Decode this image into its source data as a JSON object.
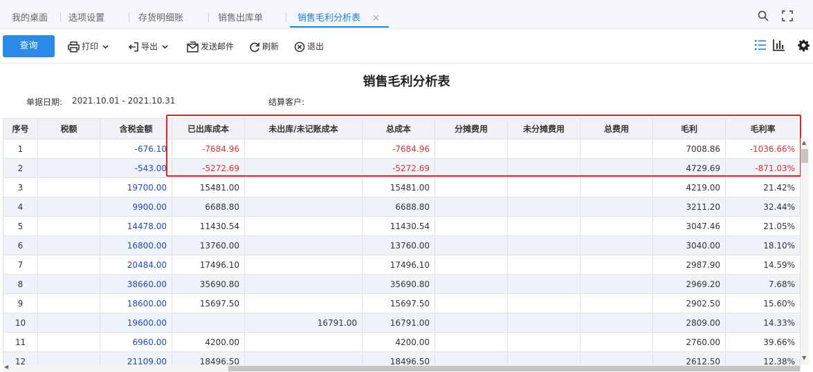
{
  "tabs": [
    {
      "label": "我的桌面"
    },
    {
      "label": "选项设置"
    },
    {
      "label": "存货明细账"
    },
    {
      "label": "销售出库单"
    },
    {
      "label": "销售毛利分析表"
    }
  ],
  "tab_close": "×",
  "toolbar": {
    "query": "查询",
    "print": "打印",
    "export": "导出",
    "send_mail": "发送邮件",
    "refresh": "刷新",
    "exit": "退出"
  },
  "report": {
    "title": "销售毛利分析表",
    "date_label": "单据日期:",
    "date_value": "2021.10.01 - 2021.10.31",
    "customer_label": "结算客户:",
    "customer_value": ""
  },
  "columns": [
    "序号",
    "税额",
    "含税金额",
    "已出库成本",
    "未出库/未记账成本",
    "总成本",
    "分摊费用",
    "未分摊费用",
    "总费用",
    "毛利",
    "毛利率"
  ],
  "rows": [
    {
      "seq": "1",
      "tax": "",
      "amount": "-676.10",
      "out_cost": "-7684.96",
      "unposted_cost": "",
      "total_cost": "-7684.96",
      "alloc_fee": "",
      "unalloc_fee": "",
      "total_fee": "",
      "profit": "7008.86",
      "margin": "-1036.66%",
      "neg": true
    },
    {
      "seq": "2",
      "tax": "",
      "amount": "-543.00",
      "out_cost": "-5272.69",
      "unposted_cost": "",
      "total_cost": "-5272.69",
      "alloc_fee": "",
      "unalloc_fee": "",
      "total_fee": "",
      "profit": "4729.69",
      "margin": "-871.03%",
      "neg": true
    },
    {
      "seq": "3",
      "tax": "",
      "amount": "19700.00",
      "out_cost": "15481.00",
      "unposted_cost": "",
      "total_cost": "15481.00",
      "alloc_fee": "",
      "unalloc_fee": "",
      "total_fee": "",
      "profit": "4219.00",
      "margin": "21.42%",
      "neg": false
    },
    {
      "seq": "4",
      "tax": "",
      "amount": "9900.00",
      "out_cost": "6688.80",
      "unposted_cost": "",
      "total_cost": "6688.80",
      "alloc_fee": "",
      "unalloc_fee": "",
      "total_fee": "",
      "profit": "3211.20",
      "margin": "32.44%",
      "neg": false
    },
    {
      "seq": "5",
      "tax": "",
      "amount": "14478.00",
      "out_cost": "11430.54",
      "unposted_cost": "",
      "total_cost": "11430.54",
      "alloc_fee": "",
      "unalloc_fee": "",
      "total_fee": "",
      "profit": "3047.46",
      "margin": "21.05%",
      "neg": false
    },
    {
      "seq": "6",
      "tax": "",
      "amount": "16800.00",
      "out_cost": "13760.00",
      "unposted_cost": "",
      "total_cost": "13760.00",
      "alloc_fee": "",
      "unalloc_fee": "",
      "total_fee": "",
      "profit": "3040.00",
      "margin": "18.10%",
      "neg": false
    },
    {
      "seq": "7",
      "tax": "",
      "amount": "20484.00",
      "out_cost": "17496.10",
      "unposted_cost": "",
      "total_cost": "17496.10",
      "alloc_fee": "",
      "unalloc_fee": "",
      "total_fee": "",
      "profit": "2987.90",
      "margin": "14.59%",
      "neg": false
    },
    {
      "seq": "8",
      "tax": "",
      "amount": "38660.00",
      "out_cost": "35690.80",
      "unposted_cost": "",
      "total_cost": "35690.80",
      "alloc_fee": "",
      "unalloc_fee": "",
      "total_fee": "",
      "profit": "2969.20",
      "margin": "7.68%",
      "neg": false
    },
    {
      "seq": "9",
      "tax": "",
      "amount": "18600.00",
      "out_cost": "15697.50",
      "unposted_cost": "",
      "total_cost": "15697.50",
      "alloc_fee": "",
      "unalloc_fee": "",
      "total_fee": "",
      "profit": "2902.50",
      "margin": "15.60%",
      "neg": false
    },
    {
      "seq": "10",
      "tax": "",
      "amount": "19600.00",
      "out_cost": "",
      "unposted_cost": "16791.00",
      "total_cost": "16791.00",
      "alloc_fee": "",
      "unalloc_fee": "",
      "total_fee": "",
      "profit": "2809.00",
      "margin": "14.33%",
      "neg": false
    },
    {
      "seq": "11",
      "tax": "",
      "amount": "6960.00",
      "out_cost": "4200.00",
      "unposted_cost": "",
      "total_cost": "4200.00",
      "alloc_fee": "",
      "unalloc_fee": "",
      "total_fee": "",
      "profit": "2760.00",
      "margin": "39.66%",
      "neg": false
    },
    {
      "seq": "12",
      "tax": "",
      "amount": "21109.00",
      "out_cost": "18496.50",
      "unposted_cost": "",
      "total_cost": "18496.50",
      "alloc_fee": "",
      "unalloc_fee": "",
      "total_fee": "",
      "profit": "2612.50",
      "margin": "12.38%",
      "neg": false
    }
  ],
  "colors": {
    "accent": "#1e7fd9",
    "button": "#2b8ae8",
    "negative": "#e0302f",
    "amount": "#2546c4",
    "highlight_box": "#e81e25"
  },
  "icons": {
    "search": "search-icon",
    "fullscreen": "fullscreen-icon",
    "print": "printer-icon",
    "export": "export-icon",
    "mail": "mail-icon",
    "refresh": "refresh-icon",
    "exit": "close-circle-icon",
    "list_view": "list-view-icon",
    "chart_view": "bar-chart-icon",
    "settings": "gear-icon"
  }
}
